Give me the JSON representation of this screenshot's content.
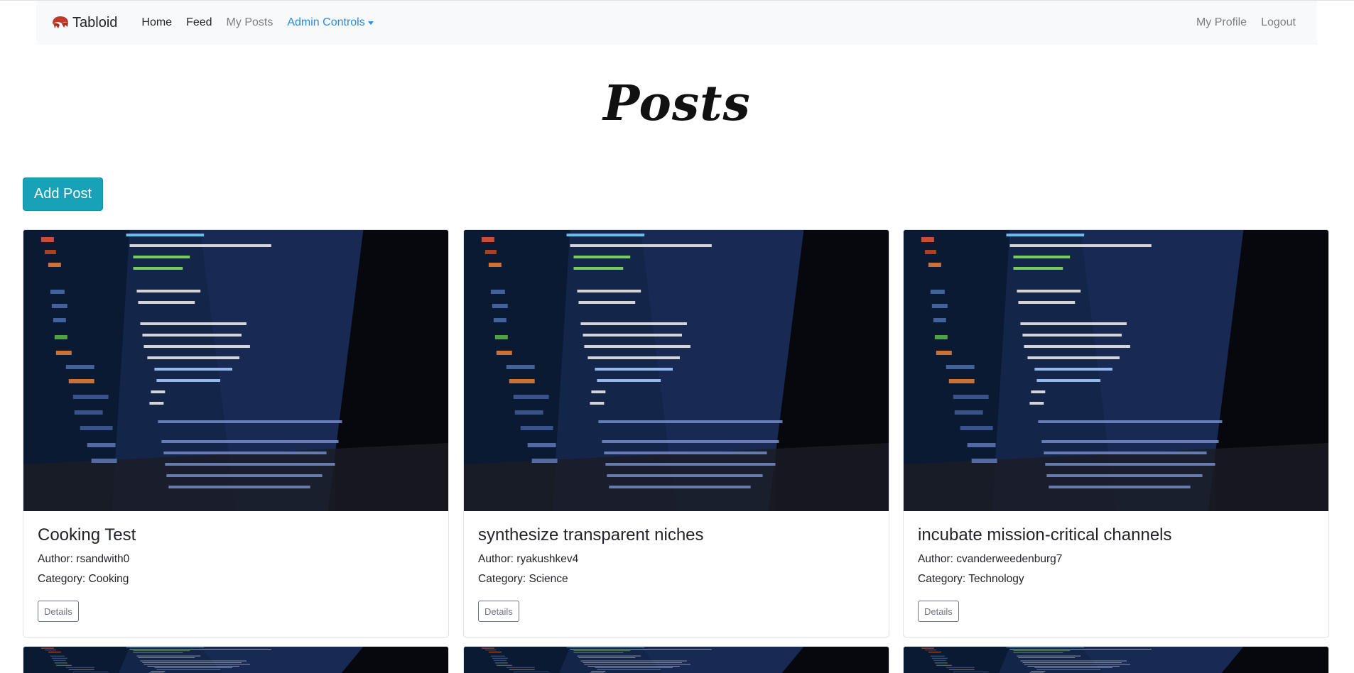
{
  "nav": {
    "brand": "Tabloid",
    "links": [
      "Home",
      "Feed",
      "My Posts"
    ],
    "admin_label": "Admin Controls",
    "right_links": [
      "My Profile",
      "Logout"
    ]
  },
  "page": {
    "title": "Posts",
    "add_button": "Add Post"
  },
  "posts": [
    {
      "title": "Cooking Test",
      "author": "Author: rsandwith0",
      "category": "Category: Cooking",
      "button": "Details"
    },
    {
      "title": "synthesize transparent niches",
      "author": "Author: ryakushkev4",
      "category": "Category: Science",
      "button": "Details"
    },
    {
      "title": "incubate mission-critical channels",
      "author": "Author: cvanderweedenburg7",
      "category": "Category: Technology",
      "button": "Details"
    }
  ],
  "colors": {
    "accent": "#2b8ce2",
    "button_info": "#17a2b8",
    "navbar_bg": "#f8f9fa"
  }
}
